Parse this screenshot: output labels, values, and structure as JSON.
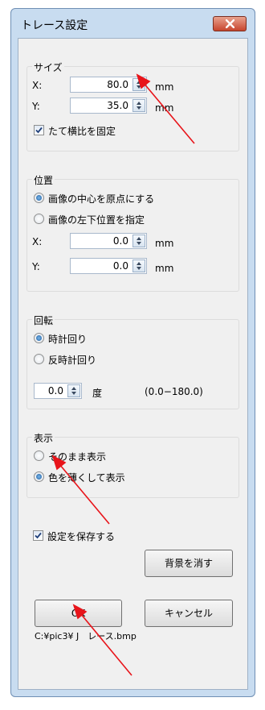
{
  "title": "トレース設定",
  "size_group": {
    "label": "サイズ",
    "x_label": "X:",
    "x_value": "80.0",
    "x_unit": "mm",
    "y_label": "Y:",
    "y_value": "35.0",
    "y_unit": "mm",
    "keep_ratio_label": "たて横比を固定",
    "keep_ratio_checked": true
  },
  "position_group": {
    "label": "位置",
    "option_center": "画像の中心を原点にする",
    "option_lower_left": "画像の左下位置を指定",
    "selected": "option_center",
    "x_label": "X:",
    "x_value": "0.0",
    "x_unit": "mm",
    "y_label": "Y:",
    "y_value": "0.0",
    "y_unit": "mm"
  },
  "rotation_group": {
    "label": "回転",
    "option_cw": "時計回り",
    "option_ccw": "反時計回り",
    "selected": "option_cw",
    "angle_value": "0.0",
    "angle_unit": "度",
    "angle_range": "(0.0−180.0)"
  },
  "display_group": {
    "label": "表示",
    "option_as_is": "そのまま表示",
    "option_faded": "色を薄くして表示",
    "selected": "option_faded"
  },
  "save_settings_label": "設定を保存する",
  "save_settings_checked": true,
  "clear_background_label": "背景を消す",
  "ok_label": "OK",
  "cancel_label": "キャンセル",
  "file_path": "C:¥pic3¥ J　レース.bmp",
  "colors": {
    "annotation_arrow": "#e8141a",
    "close_button": "#c7452e"
  }
}
